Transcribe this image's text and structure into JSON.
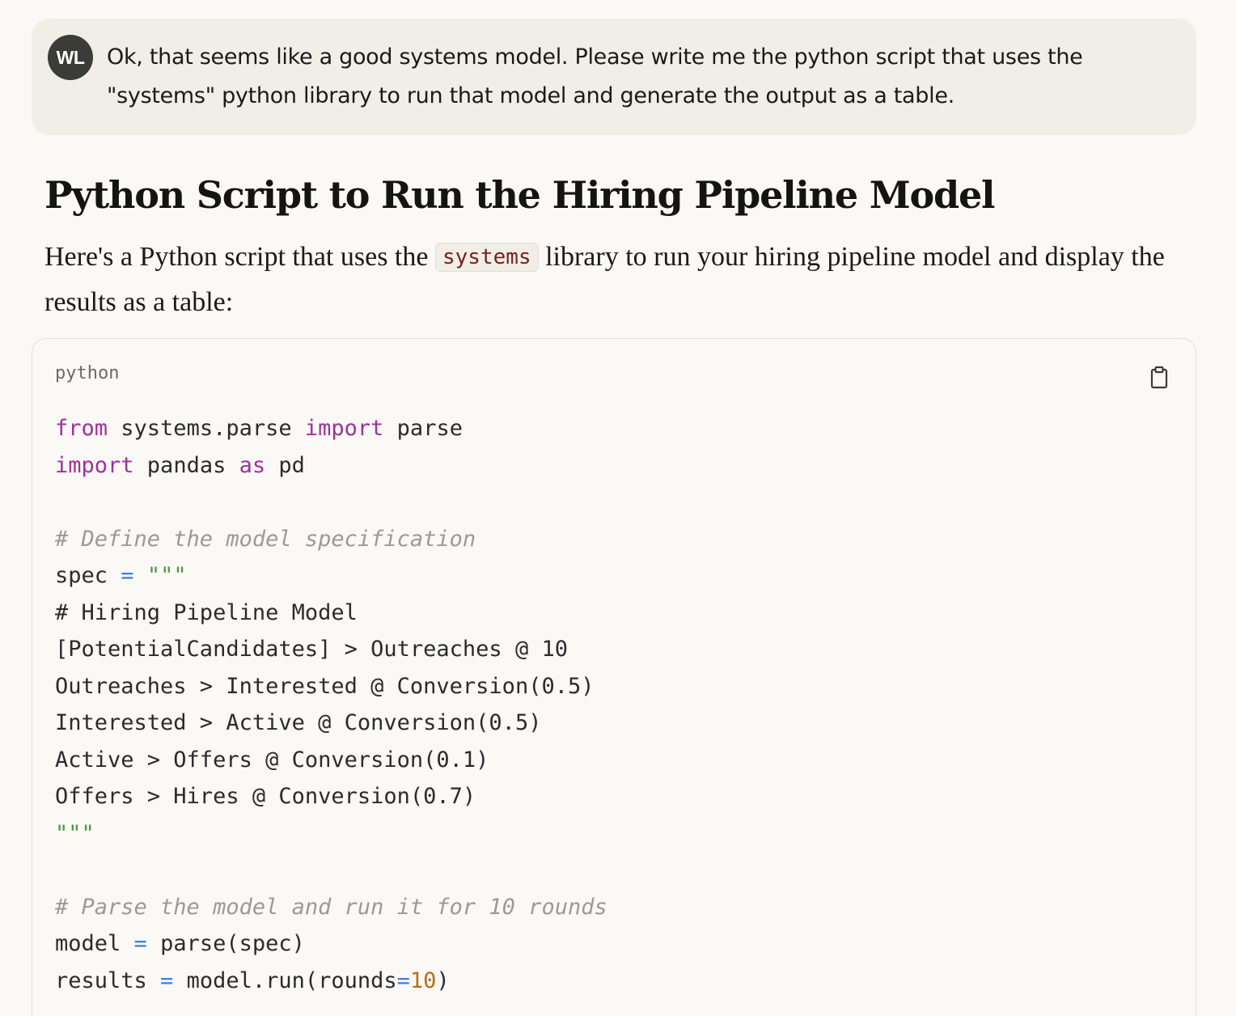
{
  "user_message": {
    "avatar_initials": "WL",
    "text": "Ok, that seems like a good systems model. Please write me the python script that uses the \"systems\" python library to run that model and generate the output as a table."
  },
  "response": {
    "heading": "Python Script to Run the Hiring Pipeline Model",
    "intro_before": "Here's a Python script that uses the ",
    "intro_code": "systems",
    "intro_after": " library to run your hiring pipeline model and display the results as a table:"
  },
  "code_block": {
    "language": "python",
    "copy_icon": "clipboard-icon",
    "lines": [
      [
        {
          "t": "kw",
          "v": "from"
        },
        {
          "t": "plain",
          "v": " systems.parse "
        },
        {
          "t": "kw",
          "v": "import"
        },
        {
          "t": "plain",
          "v": " parse"
        }
      ],
      [
        {
          "t": "kw",
          "v": "import"
        },
        {
          "t": "plain",
          "v": " pandas "
        },
        {
          "t": "kw",
          "v": "as"
        },
        {
          "t": "plain",
          "v": " pd"
        }
      ],
      [],
      [
        {
          "t": "cm",
          "v": "# Define the model specification"
        }
      ],
      [
        {
          "t": "plain",
          "v": "spec "
        },
        {
          "t": "op",
          "v": "="
        },
        {
          "t": "plain",
          "v": " "
        },
        {
          "t": "str",
          "v": "\"\"\""
        }
      ],
      [
        {
          "t": "plain",
          "v": "# Hiring Pipeline Model"
        }
      ],
      [
        {
          "t": "plain",
          "v": "[PotentialCandidates] > Outreaches @ 10"
        }
      ],
      [
        {
          "t": "plain",
          "v": "Outreaches > Interested @ Conversion(0.5)"
        }
      ],
      [
        {
          "t": "plain",
          "v": "Interested > Active @ Conversion(0.5)"
        }
      ],
      [
        {
          "t": "plain",
          "v": "Active > Offers @ Conversion(0.1)"
        }
      ],
      [
        {
          "t": "plain",
          "v": "Offers > Hires @ Conversion(0.7)"
        }
      ],
      [
        {
          "t": "str",
          "v": "\"\"\""
        }
      ],
      [],
      [
        {
          "t": "cm",
          "v": "# Parse the model and run it for 10 rounds"
        }
      ],
      [
        {
          "t": "plain",
          "v": "model "
        },
        {
          "t": "op",
          "v": "="
        },
        {
          "t": "plain",
          "v": " parse(spec)"
        }
      ],
      [
        {
          "t": "plain",
          "v": "results "
        },
        {
          "t": "op",
          "v": "="
        },
        {
          "t": "plain",
          "v": " model.run(rounds"
        },
        {
          "t": "op",
          "v": "="
        },
        {
          "t": "num",
          "v": "10"
        },
        {
          "t": "plain",
          "v": ")"
        }
      ]
    ]
  }
}
